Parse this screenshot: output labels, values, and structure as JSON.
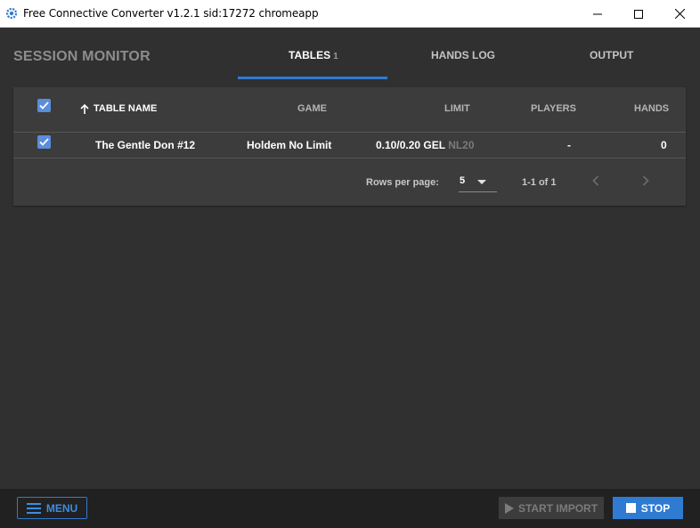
{
  "window": {
    "title": "Free Connective Converter v1.2.1 sid:17272 chromeapp",
    "minimize_icon": "minimize-icon",
    "maximize_icon": "maximize-icon",
    "close_icon": "close-icon"
  },
  "header": {
    "title": "SESSION MONITOR",
    "tabs": [
      {
        "label": "TABLES",
        "count": "1",
        "active": true
      },
      {
        "label": "HANDS LOG",
        "active": false
      },
      {
        "label": "OUTPUT",
        "active": false
      }
    ]
  },
  "table": {
    "columns": {
      "name": "TABLE NAME",
      "game": "GAME",
      "limit": "LIMIT",
      "players": "PLAYERS",
      "hands": "HANDS"
    },
    "sort_icon": "arrow-up-icon",
    "rows": [
      {
        "selected": true,
        "name": "The Gentle Don #12",
        "game": "Holdem No Limit",
        "limit": "0.10/0.20 GEL",
        "limit_short": "NL20",
        "players": "-",
        "hands": "0"
      }
    ],
    "pagination": {
      "rows_per_page_label": "Rows per page:",
      "rows_per_page": "5",
      "range": "1-1 of 1"
    }
  },
  "footer": {
    "menu_label": "MENU",
    "start_label": "START IMPORT",
    "stop_label": "STOP"
  },
  "colors": {
    "accent": "#2f7bd1",
    "background": "#303030",
    "card": "#3c3c3c",
    "bottom_bar": "#212121"
  }
}
